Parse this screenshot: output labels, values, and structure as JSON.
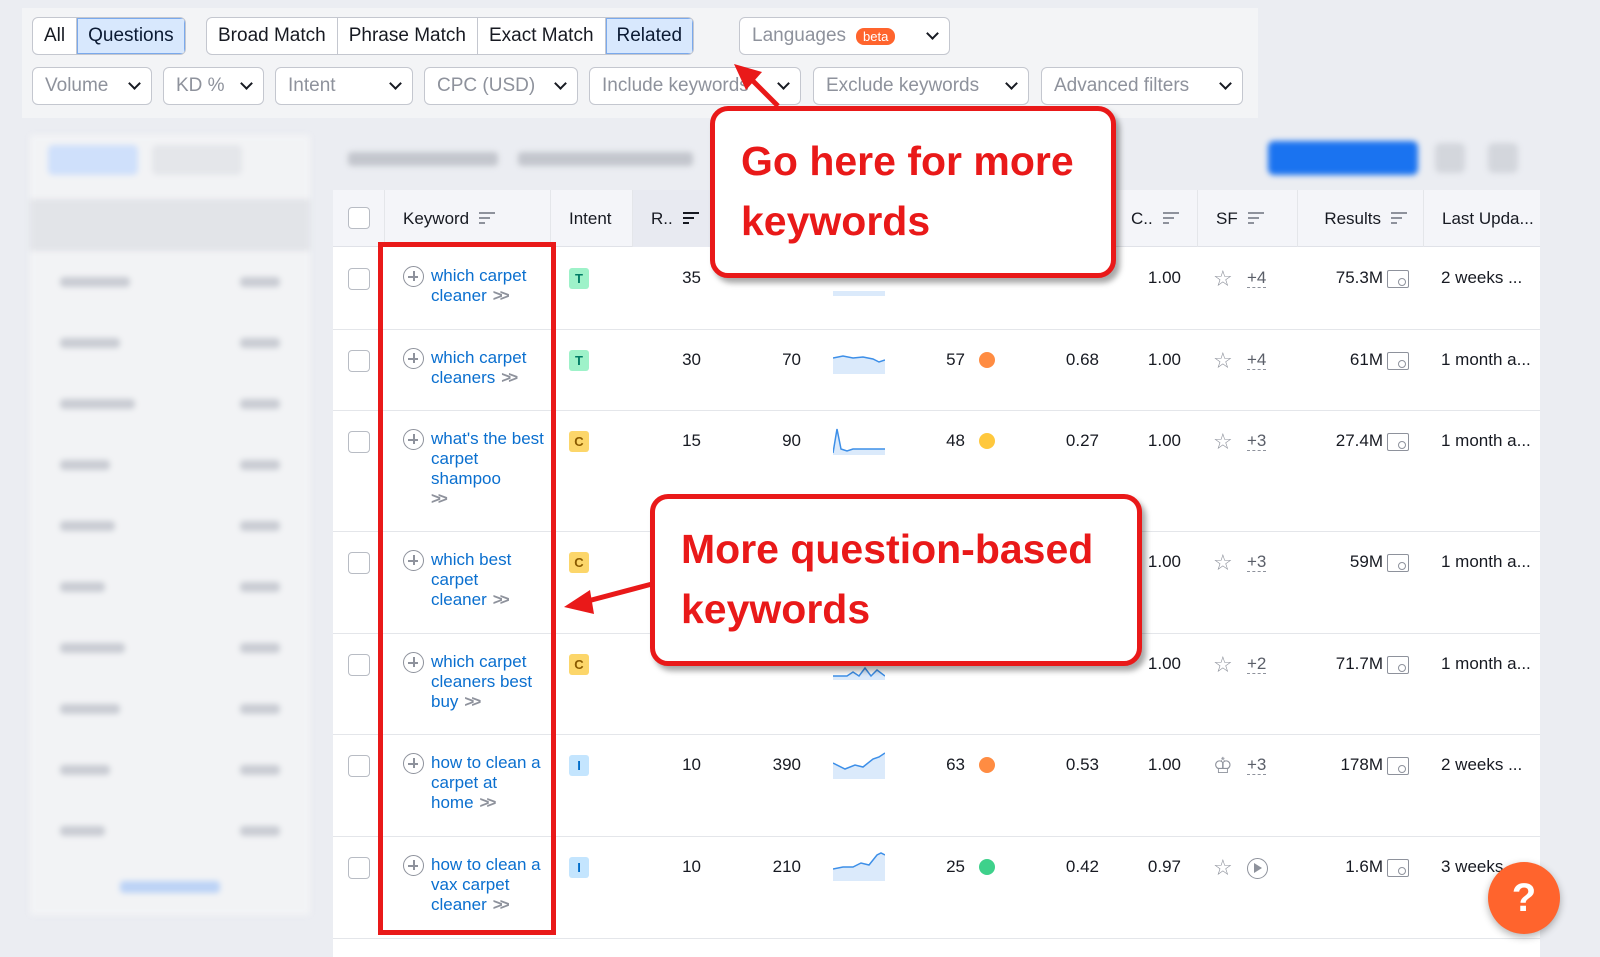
{
  "filters": {
    "match_tabs": [
      {
        "label": "All",
        "active": false
      },
      {
        "label": "Questions",
        "active": true
      }
    ],
    "type_tabs": [
      {
        "label": "Broad Match",
        "active": false
      },
      {
        "label": "Phrase Match",
        "active": false
      },
      {
        "label": "Exact Match",
        "active": false
      },
      {
        "label": "Related",
        "active": true
      }
    ],
    "languages": {
      "label": "Languages",
      "badge": "beta"
    },
    "dropdowns": [
      "Volume",
      "KD %",
      "Intent",
      "CPC (USD)",
      "Include keywords",
      "Exclude keywords",
      "Advanced filters"
    ]
  },
  "table": {
    "headers": {
      "keyword": "Keyword",
      "intent": "Intent",
      "rank": "R..",
      "competition": "C..",
      "sf": "SF",
      "results": "Results",
      "last_update": "Last Upda..."
    },
    "rows": [
      {
        "keyword": "which carpet cleaner",
        "intent": "T",
        "rank": "35",
        "volume": "",
        "kd": "",
        "kd_color": "#ff8c42",
        "cpc": "",
        "com": "1.00",
        "sf": "+4",
        "results": "75.3M",
        "updated": "2 weeks ..."
      },
      {
        "keyword": "which carpet cleaners",
        "intent": "T",
        "rank": "30",
        "volume": "70",
        "kd": "57",
        "kd_color": "#ff8c42",
        "cpc": "0.68",
        "com": "1.00",
        "sf": "+4",
        "results": "61M",
        "updated": "1 month a..."
      },
      {
        "keyword": "what's the best carpet shampoo",
        "intent": "C",
        "rank": "15",
        "volume": "90",
        "kd": "48",
        "kd_color": "#ffc83d",
        "cpc": "0.27",
        "com": "1.00",
        "sf": "+3",
        "results": "27.4M",
        "updated": "1 month a..."
      },
      {
        "keyword": "which best carpet cleaner",
        "intent": "C",
        "rank": "",
        "volume": "",
        "kd": "",
        "kd_color": "",
        "cpc": "",
        "com": "1.00",
        "sf": "+3",
        "results": "59M",
        "updated": "1 month a..."
      },
      {
        "keyword": "which carpet cleaners best buy",
        "intent": "C",
        "rank": "",
        "volume": "",
        "kd": "",
        "kd_color": "",
        "cpc": "",
        "com": "1.00",
        "sf": "+2",
        "results": "71.7M",
        "updated": "1 month a..."
      },
      {
        "keyword": "how to clean a carpet at home",
        "intent": "I",
        "rank": "10",
        "volume": "390",
        "kd": "63",
        "kd_color": "#ff8c42",
        "cpc": "0.53",
        "com": "1.00",
        "sf": "+3",
        "results": "178M",
        "updated": "2 weeks ..."
      },
      {
        "keyword": "how to clean a vax carpet cleaner",
        "intent": "I",
        "rank": "10",
        "volume": "210",
        "kd": "25",
        "kd_color": "#3ed18b",
        "cpc": "0.42",
        "com": "0.97",
        "sf": "",
        "results": "1.6M",
        "updated": "3 weeks..."
      }
    ]
  },
  "annotations": {
    "callout_top": "Go here for more keywords",
    "callout_mid": "More question-based keywords"
  },
  "help_label": "?"
}
